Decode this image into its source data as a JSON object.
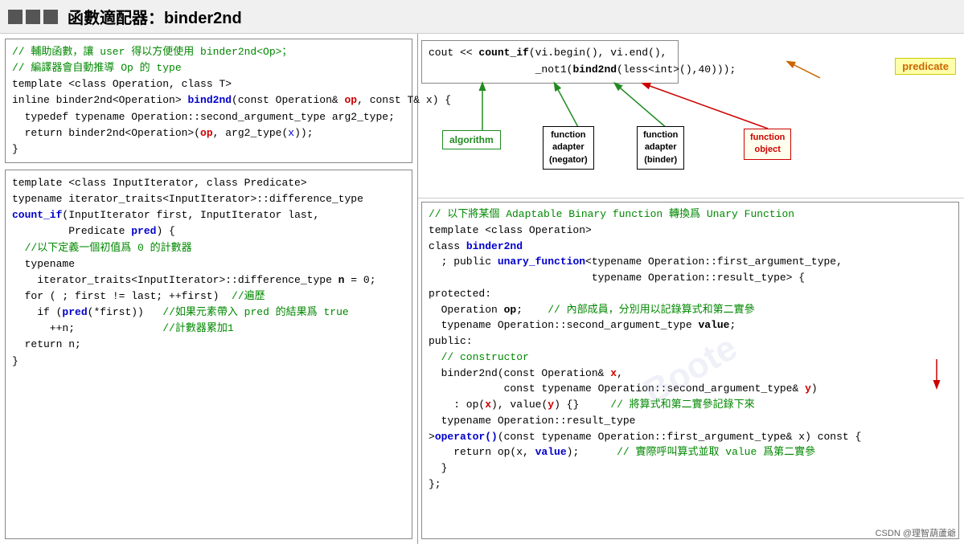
{
  "title": {
    "squares": [
      "sq1",
      "sq2",
      "sq3"
    ],
    "text": "函數適配器：binder2nd"
  },
  "topleft_code": {
    "lines": [
      {
        "text": "// 輔助函數，讓 user 得以方便使用 binder2nd<Op>；",
        "color": "comment"
      },
      {
        "text": "// 編譯器會自動推導 Op 的 type",
        "color": "comment"
      },
      {
        "text": "template <class Operation, class T>",
        "color": "black"
      },
      {
        "text": "inline binder2nd<Operation> bind2nd(const Operation& op, const T& x) {",
        "color": "mixed"
      },
      {
        "text": "  typedef typename Operation::second_argument_type arg2_type;",
        "color": "black"
      },
      {
        "text": "  return binder2nd<Operation>(op, arg2_type(x));",
        "color": "mixed"
      },
      {
        "text": "}",
        "color": "black"
      }
    ]
  },
  "bottomleft_code": {
    "lines": [
      "template <class InputIterator, class Predicate>",
      "typename iterator_traits<InputIterator>::difference_type",
      "count_if(InputIterator first, InputIterator last,",
      "         Predicate pred) {",
      "  //以下定義一個初值爲 0 的計數器",
      "  typename",
      "    iterator_traits<InputIterator>::difference_type n = 0;",
      "  for ( ; first != last; ++first)  //遍歷",
      "    if (pred(*first))   //如果元素帶入 pred 的結果爲 true",
      "      ++n;              //計數器累加1",
      "  return n;",
      "}"
    ]
  },
  "topright_code": {
    "line1": "cout << count_if(vi.begin(), vi.end(),",
    "line2": "                 _not1(bind2nd(less<int>(),40)));"
  },
  "diagram": {
    "algorithm_label": "algorithm",
    "fa_negator_label": "function\nadapter\n(negator)",
    "fa_binder_label": "function\nadapter\n(binder)",
    "fo_label": "function\nobject",
    "predicate_label": "predicate"
  },
  "bottomright_code": {
    "comment1": "// 以下將某個 Adaptable Binary function 轉換爲 Unary Function",
    "lines": [
      "template <class Operation>",
      "class binder2nd",
      "  ; public unary_function<typename Operation::first_argument_type,",
      "                          typename Operation::result_type> {",
      "protected:",
      "  Operation op;    // 內部成員，分別用以記錄算式和第二實參",
      "  typename Operation::second_argument_type value;",
      "public:",
      "  // constructor",
      "  binder2nd(const Operation& x,",
      "            const typename Operation::second_argument_type& y)",
      "    : op(x), value(y) {}     // 將算式和第二實參記錄下來",
      "  typename Operation::result_type",
      ">operator()(const typename Operation::first_argument_type& x) const {",
      "    return op(x, value);      // 實際呼叫算式並取 value 爲第二實參",
      "  }",
      "};"
    ]
  },
  "footer": "CSDN @理智葫蘆爺"
}
